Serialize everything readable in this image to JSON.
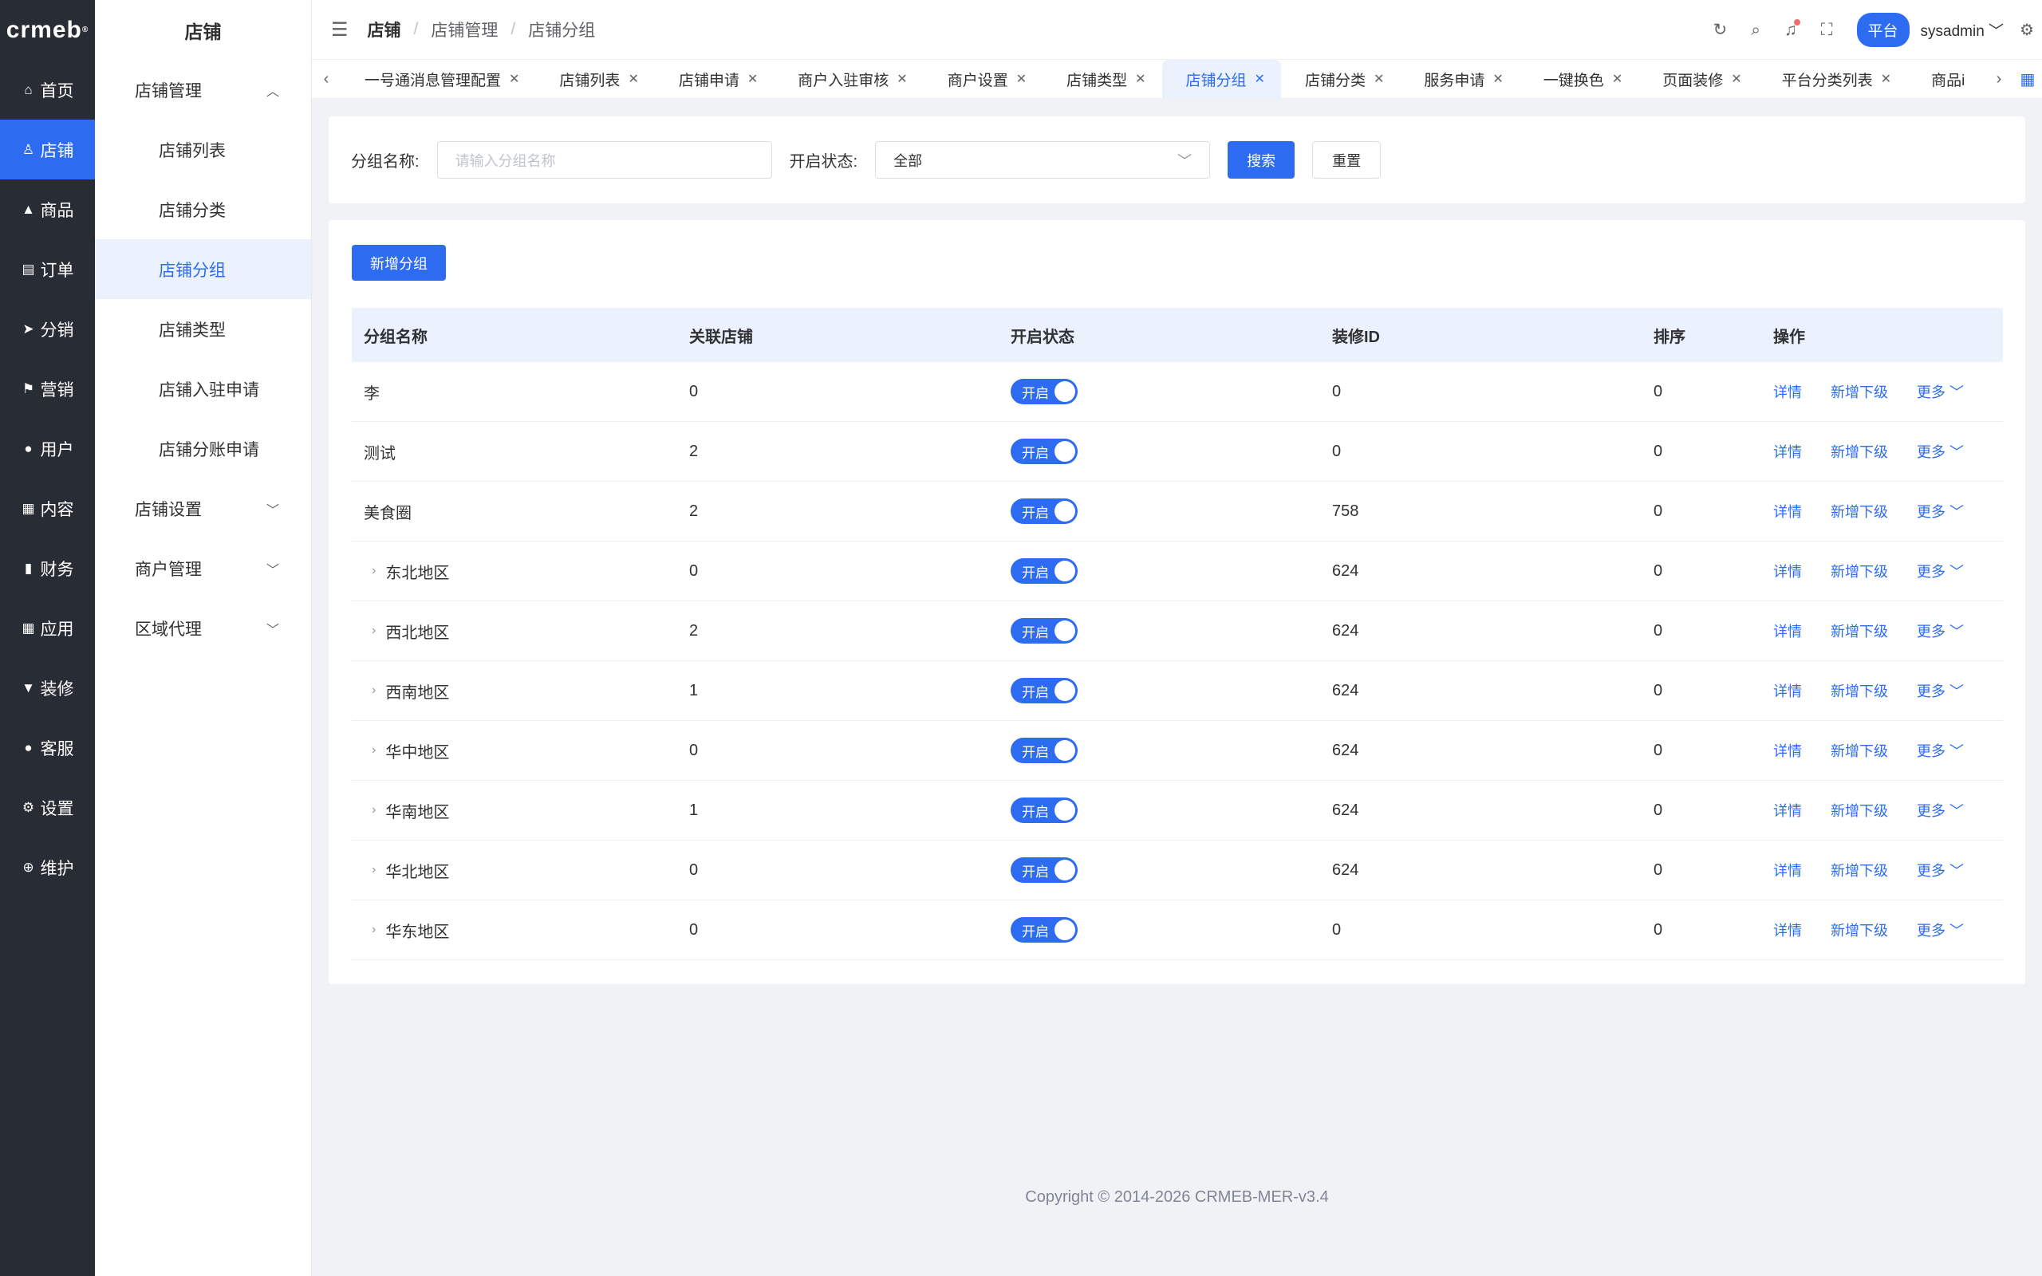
{
  "rail": {
    "logo": "crmeb",
    "items": [
      {
        "label": "首页",
        "icon": "home-icon",
        "glyph": "⌂"
      },
      {
        "label": "店铺",
        "icon": "store-icon",
        "glyph": "♙"
      },
      {
        "label": "商品",
        "icon": "goods-icon",
        "glyph": "▲"
      },
      {
        "label": "订单",
        "icon": "order-icon",
        "glyph": "▤"
      },
      {
        "label": "分销",
        "icon": "send-icon",
        "glyph": "➤"
      },
      {
        "label": "营销",
        "icon": "flag-icon",
        "glyph": "⚑"
      },
      {
        "label": "用户",
        "icon": "user-icon",
        "glyph": "●"
      },
      {
        "label": "内容",
        "icon": "book-icon",
        "glyph": "▦"
      },
      {
        "label": "财务",
        "icon": "chart-icon",
        "glyph": "▮"
      },
      {
        "label": "应用",
        "icon": "grid-icon",
        "glyph": "▦"
      },
      {
        "label": "装修",
        "icon": "brush-icon",
        "glyph": "▼"
      },
      {
        "label": "客服",
        "icon": "service-icon",
        "glyph": "●"
      },
      {
        "label": "设置",
        "icon": "gear-icon",
        "glyph": "⚙"
      },
      {
        "label": "维护",
        "icon": "maintain-icon",
        "glyph": "⊕"
      }
    ],
    "active_index": 1
  },
  "side": {
    "title": "店铺",
    "group_store_manage": "店铺管理",
    "items": [
      "店铺列表",
      "店铺分类",
      "店铺分组",
      "店铺类型",
      "店铺入驻申请",
      "店铺分账申请"
    ],
    "active_item": "店铺分组",
    "groups_collapsed": [
      "店铺设置",
      "商户管理",
      "区域代理"
    ]
  },
  "header": {
    "crumb_root": "店铺",
    "crumb_mid": "店铺管理",
    "crumb_cur": "店铺分组",
    "platform": "平台",
    "username": "sysadmin"
  },
  "tabs": [
    {
      "label": "一号通消息管理配置"
    },
    {
      "label": "店铺列表"
    },
    {
      "label": "店铺申请"
    },
    {
      "label": "商户入驻审核"
    },
    {
      "label": "商户设置"
    },
    {
      "label": "店铺类型"
    },
    {
      "label": "店铺分组",
      "active": true
    },
    {
      "label": "店铺分类"
    },
    {
      "label": "服务申请"
    },
    {
      "label": "一键换色"
    },
    {
      "label": "页面装修"
    },
    {
      "label": "平台分类列表"
    },
    {
      "label": "商品i"
    }
  ],
  "filter": {
    "name_label": "分组名称:",
    "name_placeholder": "请输入分组名称",
    "status_label": "开启状态:",
    "status_value": "全部",
    "search_btn": "搜索",
    "reset_btn": "重置"
  },
  "table": {
    "add_btn": "新增分组",
    "headers": [
      "分组名称",
      "关联店铺",
      "开启状态",
      "装修ID",
      "排序",
      "操作"
    ],
    "rows": [
      {
        "name": "李",
        "shops": "0",
        "status": "开启",
        "deco_id": "0",
        "sort": "0",
        "expandable": false
      },
      {
        "name": "测试",
        "shops": "2",
        "status": "开启",
        "deco_id": "0",
        "sort": "0",
        "expandable": false
      },
      {
        "name": "美食圈",
        "shops": "2",
        "status": "开启",
        "deco_id": "758",
        "sort": "0",
        "expandable": false
      },
      {
        "name": "东北地区",
        "shops": "0",
        "status": "开启",
        "deco_id": "624",
        "sort": "0",
        "expandable": true
      },
      {
        "name": "西北地区",
        "shops": "2",
        "status": "开启",
        "deco_id": "624",
        "sort": "0",
        "expandable": true
      },
      {
        "name": "西南地区",
        "shops": "1",
        "status": "开启",
        "deco_id": "624",
        "sort": "0",
        "expandable": true
      },
      {
        "name": "华中地区",
        "shops": "0",
        "status": "开启",
        "deco_id": "624",
        "sort": "0",
        "expandable": true
      },
      {
        "name": "华南地区",
        "shops": "1",
        "status": "开启",
        "deco_id": "624",
        "sort": "0",
        "expandable": true
      },
      {
        "name": "华北地区",
        "shops": "0",
        "status": "开启",
        "deco_id": "624",
        "sort": "0",
        "expandable": true
      },
      {
        "name": "华东地区",
        "shops": "0",
        "status": "开启",
        "deco_id": "0",
        "sort": "0",
        "expandable": true
      }
    ],
    "op_detail": "详情",
    "op_add_child": "新增下级",
    "op_more": "更多"
  },
  "footer": "Copyright © 2014-2026 CRMEB-MER-v3.4",
  "colors": {
    "primary": "#2d6cf0",
    "rail_bg": "#282c34",
    "active_bg": "#ebf2fe"
  }
}
